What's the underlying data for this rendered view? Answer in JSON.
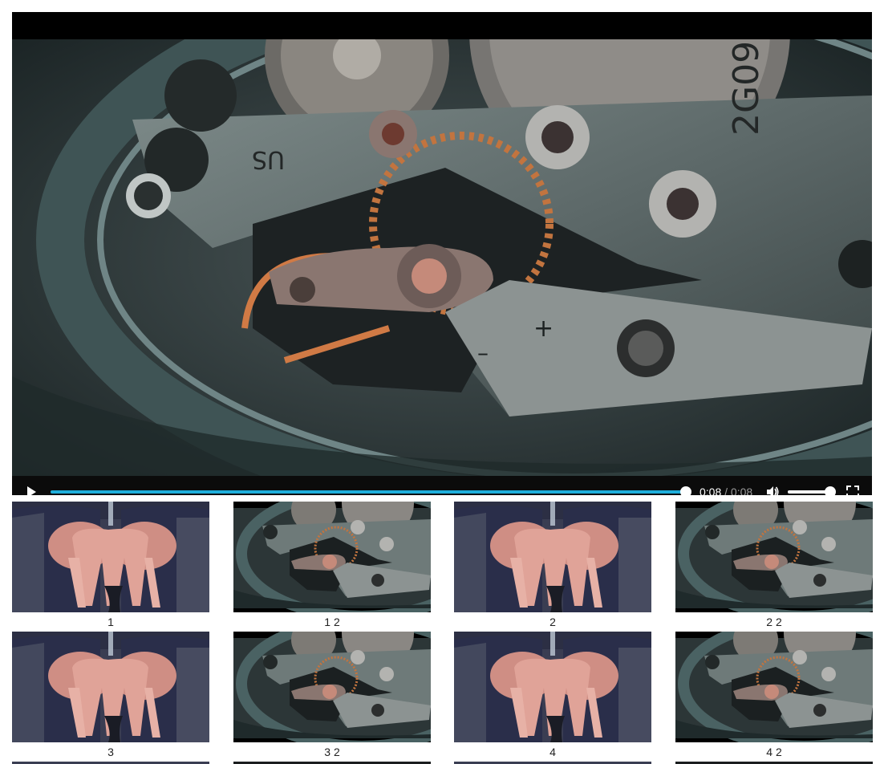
{
  "player": {
    "current_time": "0:08",
    "separator": "/",
    "duration": "0:08",
    "progress": 1.0,
    "volume": 1.0,
    "icons": {
      "play": "play-icon",
      "volume": "volume-icon",
      "fullscreen": "fullscreen-icon"
    }
  },
  "playlist": [
    {
      "caption": "1",
      "image": "hands-washing"
    },
    {
      "caption": "1 2",
      "image": "watch-movement"
    },
    {
      "caption": "2",
      "image": "hands-washing"
    },
    {
      "caption": "2 2",
      "image": "watch-movement"
    },
    {
      "caption": "3",
      "image": "hands-washing"
    },
    {
      "caption": "3 2",
      "image": "watch-movement"
    },
    {
      "caption": "4",
      "image": "hands-washing"
    },
    {
      "caption": "4 2",
      "image": "watch-movement"
    }
  ],
  "colors": {
    "accent": "#1eaedb",
    "control_bar": "#0b0b0b"
  }
}
